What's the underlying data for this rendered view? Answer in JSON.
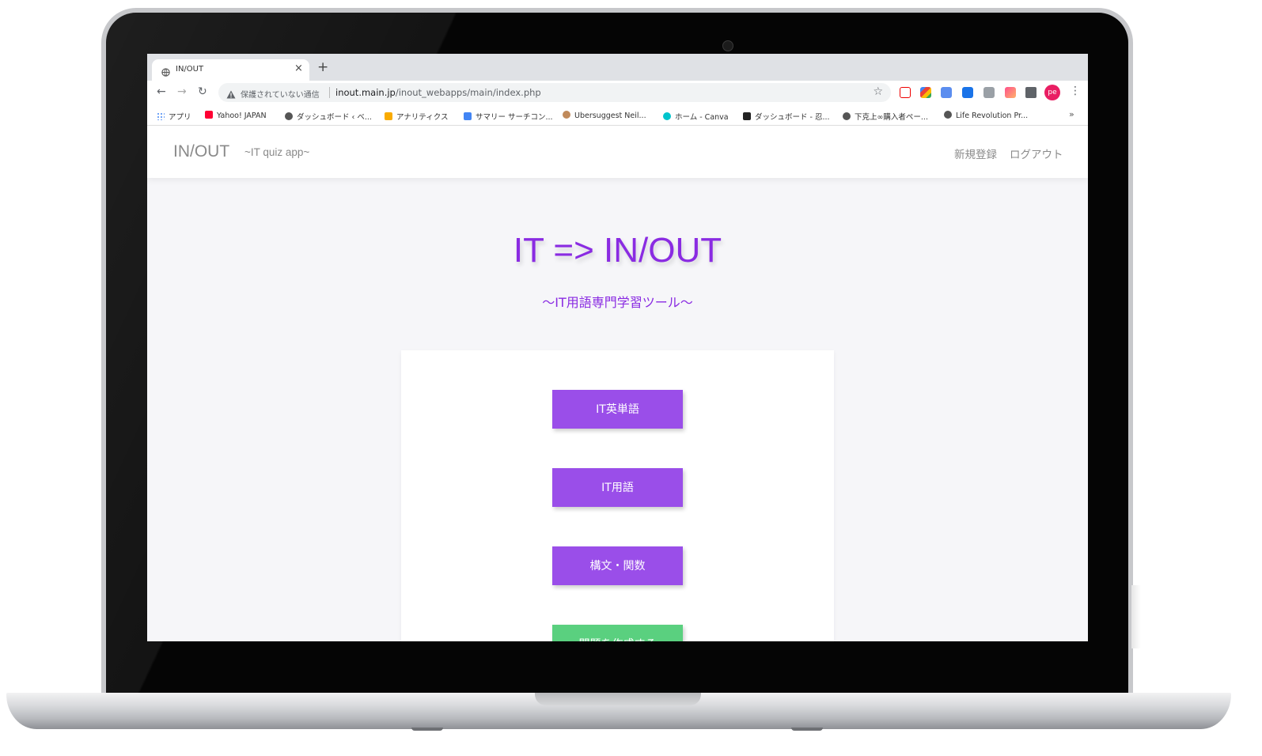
{
  "browser": {
    "tab": {
      "title": "IN/OUT",
      "close": "×"
    },
    "new_tab": "+",
    "nav": {
      "back": "←",
      "forward": "→",
      "reload": "↻"
    },
    "address": {
      "security_label": "保護されていない通信",
      "url_host": "inout.main.jp",
      "url_path": "/inout_webapps/main/index.php"
    },
    "star": "☆",
    "profile": "pe",
    "menu": "⋮",
    "bookmarks": [
      {
        "label": "アプリ",
        "icon": "apps-grid-icon",
        "color": "#4285f4"
      },
      {
        "label": "Yahoo! JAPAN",
        "icon": "yahoo-icon",
        "color": "#ff0033"
      },
      {
        "label": "ダッシュボード ‹ ベ...",
        "icon": "user-icon",
        "color": "#555555"
      },
      {
        "label": "アナリティクス",
        "icon": "analytics-icon",
        "color": "#f9ab00"
      },
      {
        "label": "サマリー サーチコン...",
        "icon": "search-console-icon",
        "color": "#4285f4"
      },
      {
        "label": "Ubersuggest Neil...",
        "icon": "ubersuggest-icon",
        "color": "#c08a5b"
      },
      {
        "label": "ホーム - Canva",
        "icon": "canva-icon",
        "color": "#00c4cc"
      },
      {
        "label": "ダッシュボード - 忍...",
        "icon": "ninja-icon",
        "color": "#222222"
      },
      {
        "label": "下克上∞購入者ペー...",
        "icon": "globe-icon",
        "color": "#555555"
      },
      {
        "label": "Life Revolution Pr...",
        "icon": "globe-icon",
        "color": "#555555"
      }
    ],
    "bookmarks_more": "»"
  },
  "site": {
    "brand": "IN/OUT",
    "tagline": "~IT quiz app~",
    "nav_links": [
      "新規登録",
      "ログアウト"
    ],
    "hero_title": "IT => IN/OUT",
    "hero_subtitle": "〜IT用語専門学習ツール〜",
    "buttons": [
      {
        "label": "IT英単語",
        "color": "#9a4ee9"
      },
      {
        "label": "IT用語",
        "color": "#9a4ee9"
      },
      {
        "label": "構文・関数",
        "color": "#9a4ee9"
      },
      {
        "label": "問題を作成する",
        "color": "#5ad07f"
      }
    ]
  }
}
